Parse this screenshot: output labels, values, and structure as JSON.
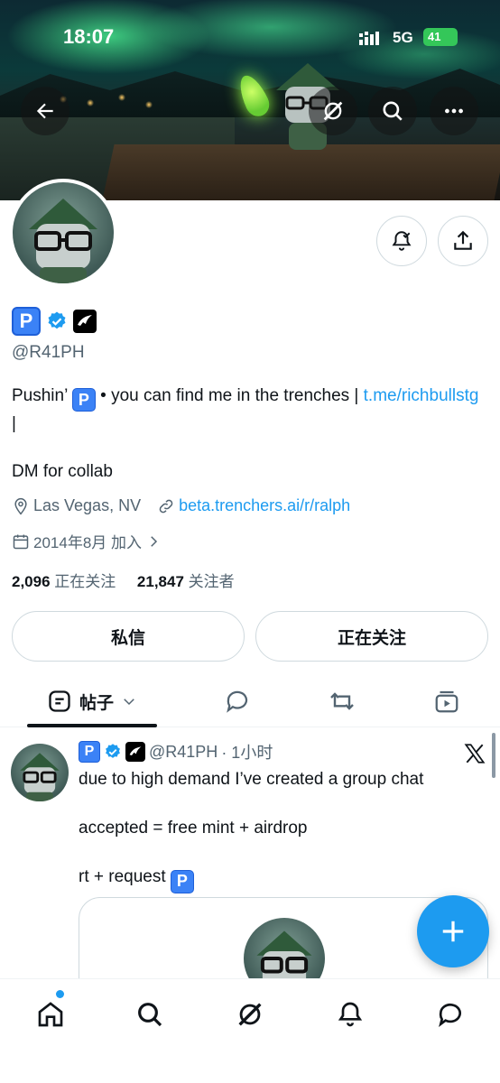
{
  "status_bar": {
    "time": "18:07",
    "network": "5G",
    "battery": "41"
  },
  "profile": {
    "name_badge": "P",
    "handle": "@R41PH",
    "bio": {
      "text_before": "Pushin’",
      "badge": "P",
      "text_after": " • you can find me in the trenches | ",
      "link": "t.me/richbullstg",
      "text_end": " |"
    },
    "dm_line": "DM for collab",
    "location": "Las Vegas, NV",
    "website": "beta.trenchers.ai/r/ralph",
    "joined": "2014年8月 加入",
    "following_count": "2,096",
    "following_label": "正在关注",
    "followers_count": "21,847",
    "followers_label": "关注者"
  },
  "actions": {
    "dm_label": "私信",
    "following_label": "正在关注"
  },
  "tabs": {
    "posts_label": "帖子"
  },
  "post": {
    "badge": "P",
    "handle": "@R41PH",
    "time": "· 1小时",
    "line1": "due to high demand I’ve created a group chat",
    "line2": "accepted = free mint + airdrop",
    "line3_text": "rt + request ",
    "line3_badge": "P"
  },
  "colors": {
    "accent": "#1d9bf0",
    "badge_blue": "#3b82f6",
    "text": "#0f1419",
    "muted": "#536471"
  }
}
